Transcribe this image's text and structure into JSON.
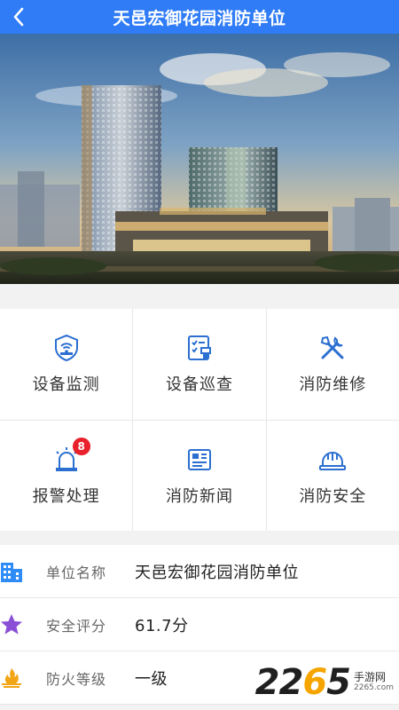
{
  "header": {
    "title": "天邑宏御花园消防单位",
    "back_icon": "chevron-left-icon",
    "background": "#2f7cf6"
  },
  "menu": [
    {
      "label": "设备监测",
      "icon": "device-monitor-icon"
    },
    {
      "label": "设备巡查",
      "icon": "device-patrol-icon"
    },
    {
      "label": "消防维修",
      "icon": "repair-tools-icon"
    },
    {
      "label": "报警处理",
      "icon": "alarm-siren-icon",
      "badge": "8"
    },
    {
      "label": "消防新闻",
      "icon": "news-icon"
    },
    {
      "label": "消防安全",
      "icon": "safety-helmet-icon"
    }
  ],
  "info": [
    {
      "key": "单位名称",
      "value": "天邑宏御花园消防单位",
      "icon": "building-icon",
      "color": "#2f8cf6"
    },
    {
      "key": "安全评分",
      "value": "61.7分",
      "icon": "star-icon",
      "color": "#8a4fd6"
    },
    {
      "key": "防火等级",
      "value": "一级",
      "icon": "fire-level-icon",
      "color": "#f2a516"
    }
  ],
  "watermark": {
    "num_a": "22",
    "num_o": "6",
    "num_b": "5",
    "line1": "手游网",
    "line2": "2265.com"
  },
  "colors": {
    "accent": "#2f7cf6",
    "icon_blue": "#2b6fd0",
    "badge": "#e8212a"
  }
}
